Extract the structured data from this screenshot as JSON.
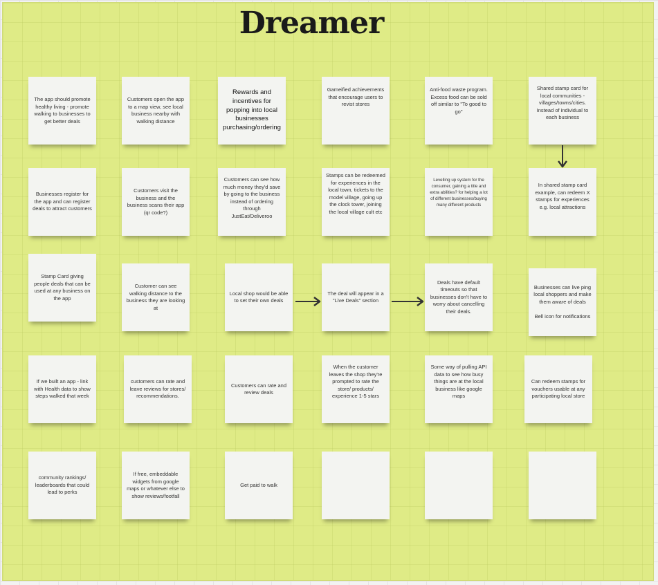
{
  "board": {
    "title": "Dreamer"
  },
  "notes": [
    "The app should promote healthy living - promote walking to businesses to get better deals",
    "Customers open the app to a map view, see local business nearby with walking distance",
    "Rewards and incentives for popping into local businesses purchasing/ordering",
    "Gameified achievements that encourage users to revist stores",
    "Anti-food waste program. Excess food can be sold off similar to \"To good to go\"",
    "Shared stamp card for local communities - villages/towns/cities. Instead of individual to each business",
    "Businesses register for the app and can register deals to attract customers",
    "Customers visit the business and the business scans their app (qr code?)",
    "Customers can see how much money they'd save by going to the business instead of ordering through JustEat/Deliveroo",
    "Stamps can be redeemed for experiences in the local town, tickets to the model village, going up the clock tower, joining the local village cult etc",
    "Levelling up system for the consumer, gaining a title and extra abilities? for helping a lot of different businesses/buying many different products",
    "In shared stamp card example, can redeem X stamps for experiences e.g. local attractions",
    "Stamp Card giving people deals that can be used at any business on the app",
    "Customer can see walking distance to the business they are looking at",
    "Local shop would be able to set their own deals",
    "The deal will appear in a \"Live Deals\" section",
    "Deals have default timeouts so that businesses don't have to worry about cancelling their deals.",
    "Businesses can live ping local shoppers and make them aware of deals\n\nBell icon for notifications",
    "If we built an app - link with Health data to show steps walked that week",
    "customers can rate and leave reviews for stores/ recommendations.",
    "Customers can rate and review deals",
    "When the customer leaves the shop they're prompted to rate the store/ products/ experience 1-5 stars",
    "Some way of pulling API data to see how busy things are at the local business like google maps",
    "Can redeem stamps for vouchers usable at any participating local store",
    "community rankings/ leaderboards that could lead to perks",
    "If free, embeddable widgets from google maps or whatever else to show reviews/footfall",
    "Get paid to walk",
    "",
    "",
    ""
  ]
}
